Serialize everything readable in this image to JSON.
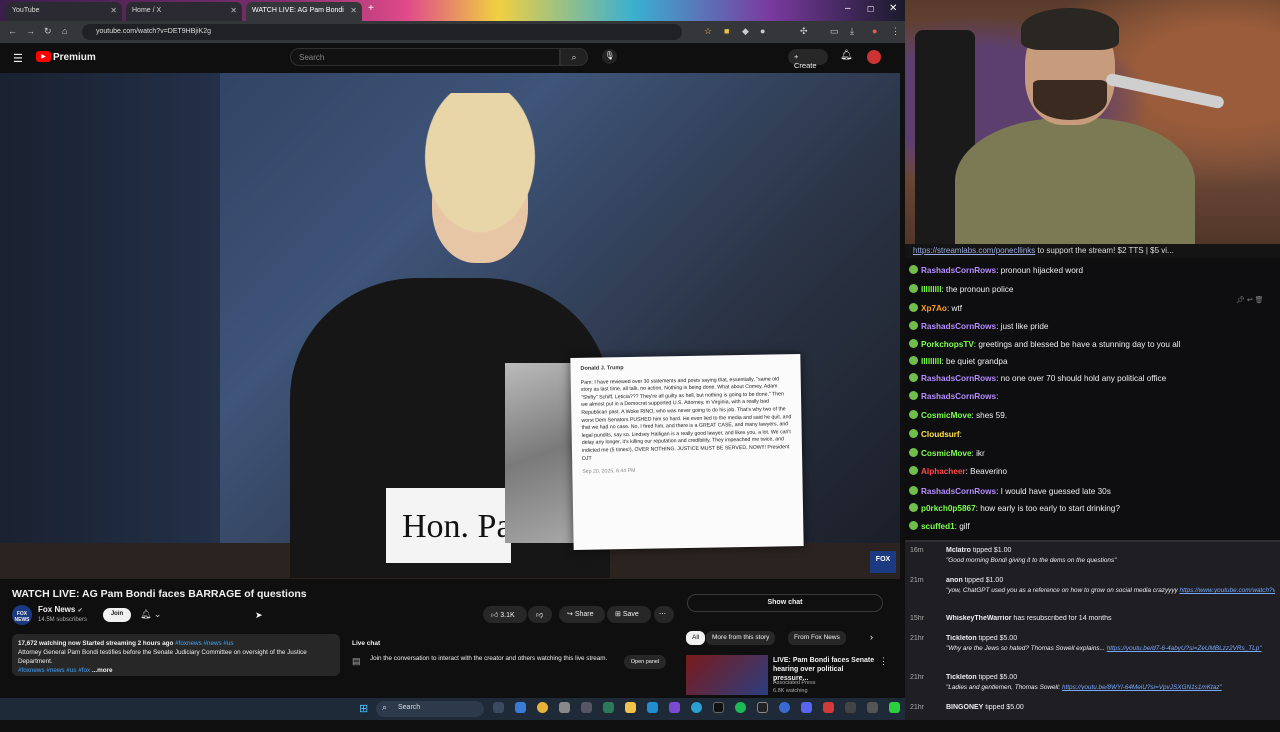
{
  "browser": {
    "tabs": [
      {
        "label": "YouTube"
      },
      {
        "label": "Home / X"
      },
      {
        "label": "WATCH LIVE: AG Pam Bondi"
      }
    ],
    "url": "youtube.com/watch?v=DET9HBjiK2g"
  },
  "youtube": {
    "brand": "Premium",
    "search_placeholder": "Search",
    "create_label": "Create",
    "video": {
      "namecard_text": "Hon. Pam",
      "network_bug": "FOX",
      "tweet": {
        "header": "Donald J. Trump",
        "body": "Pam: I have reviewed over 30 statements and posts saying that, essentially, \"same old story as last time, all talk, no action. Nothing is being done. What about Comey, Adam \"Shifty\" Schiff, Leticia??? They're all guilty as hell, but nothing is going to be done.\" Then we almost put in a Democrat supported U.S. Attorney, in Virginia, with a really bad Republican past. A Woke RINO, who was never going to do his job. That's why two of the worst Dem Senators PUSHED him so hard. He even lied to the media and said he quit, and that we had no case. No, I fired him, and there is a GREAT CASE, and many lawyers, and legal pundits, say so. Lindsey Halligan is a really good lawyer, and likes you, a lot. We can't delay any longer, it's killing our reputation and credibility. They impeached me twice, and indicted me (5 times!), OVER NOTHING. JUSTICE MUST BE SERVED, NOW!!! President DJT",
        "footer": "Sep 20, 2025, 6:44 PM"
      }
    },
    "title": "WATCH LIVE: AG Pam Bondi faces BARRAGE of questions",
    "channel": {
      "name": "Fox News",
      "subscribers": "14.5M subscribers",
      "avatar_text": "FOX NEWS",
      "join_label": "Join"
    },
    "actions": {
      "likes": "3.1K",
      "share": "Share",
      "save": "Save"
    },
    "description": {
      "stats": "17,672 watching now  Started streaming 2 hours ago",
      "tags_inline": "#foxnews #news #us",
      "text": "Attorney General Pam Bondi testifies before the Senate Judiciary Committee on oversight of the Justice Department.",
      "tags_end": "#foxnews #news #us #fox",
      "more": "...more"
    },
    "live_chat": {
      "label": "Live chat",
      "text": "Join the conversation to interact with the creator and others watching this live stream.",
      "open_panel": "Open panel"
    },
    "show_chat": "Show chat",
    "chips": [
      "All",
      "More from this story",
      "From Fox News"
    ],
    "recommended": {
      "title": "LIVE: Pam Bondi faces Senate hearing over political pressure...",
      "channel": "Associated Press",
      "watching": "6.8K watching"
    }
  },
  "taskbar": {
    "search": "Search"
  },
  "stream": {
    "ticker_link": "https://streamlabs.com/ponecllinks",
    "ticker_text": " to support the stream! $2 TTS | $5 vi..."
  },
  "chat": [
    {
      "user": "RashadsCornRows",
      "color": "#b58cff",
      "text": "pronoun hijacked word"
    },
    {
      "user": "lllllllll",
      "color": "#7cff4a",
      "text": "the pronoun police"
    },
    {
      "user": "Xp7Ao",
      "color": "#ff9f1a",
      "text": "wtf"
    },
    {
      "user": "RashadsCornRows",
      "color": "#b58cff",
      "text": "just like pride"
    },
    {
      "user": "PorkchopsTV",
      "color": "#7cff4a",
      "text": "greetings and blessed be have a stunning day to you all"
    },
    {
      "user": "lllllllll",
      "color": "#7cff4a",
      "text": "be quiet grandpa"
    },
    {
      "user": "RashadsCornRows",
      "color": "#b58cff",
      "text": "no one over 70 should hold any political office"
    },
    {
      "user": "RashadsCornRows",
      "color": "#b58cff",
      "text": ""
    },
    {
      "user": "CosmicMove",
      "color": "#7cff4a",
      "text": "shes 59."
    },
    {
      "user": "Cloudsurf",
      "color": "#ffe14a",
      "text": ""
    },
    {
      "user": "CosmicMove",
      "color": "#7cff4a",
      "text": "ikr"
    },
    {
      "user": "Alphacheer",
      "color": "#ff4a4a",
      "text": "Beaverino"
    },
    {
      "user": "RashadsCornRows",
      "color": "#b58cff",
      "text": "I would have guessed late 30s"
    },
    {
      "user": "p0rkch0p5867",
      "color": "#7cff4a",
      "text": "how early is too early to start drinking?"
    },
    {
      "user": "scuffed1",
      "color": "#7cff4a",
      "text": "gilf"
    }
  ],
  "tips": [
    {
      "time": "16m",
      "name": "Mclatro",
      "action": "tipped $1.00",
      "message": "\"Good morning Bondi giving it to the dems on the questions\"",
      "link": ""
    },
    {
      "time": "21m",
      "name": "anon",
      "action": "tipped $1.00",
      "message": "\"yow, ChatGPT used you as a reference on how to grow on social media crazyyyy ",
      "link": "https://www.youtube.com/watch?v=lKydMhgzuoQ\""
    },
    {
      "time": "15hr",
      "name": "WhiskeyTheWarrior",
      "action": "has resubscribed for 14 months",
      "message": "",
      "link": ""
    },
    {
      "time": "21hr",
      "name": "Tickleton",
      "action": "tipped $5.00",
      "message": "\"Why are the Jews so hated? Thomas Sowell explains... ",
      "link": "https://youtu.be/d7-6-4abyU?si=ZeUMBLzz2VRs_TLp\""
    },
    {
      "time": "21hr",
      "name": "Tickleton",
      "action": "tipped $5.00",
      "message": "\"Ladies and gentlemen, Thomas Sowell: ",
      "link": "https://youtu.be/8WYl-64MeiU?si=VpvJSXGN1s1mKtaz\""
    },
    {
      "time": "21hr",
      "name": "BINGONEY",
      "action": "tipped $5.00",
      "message": "",
      "link": ""
    }
  ]
}
